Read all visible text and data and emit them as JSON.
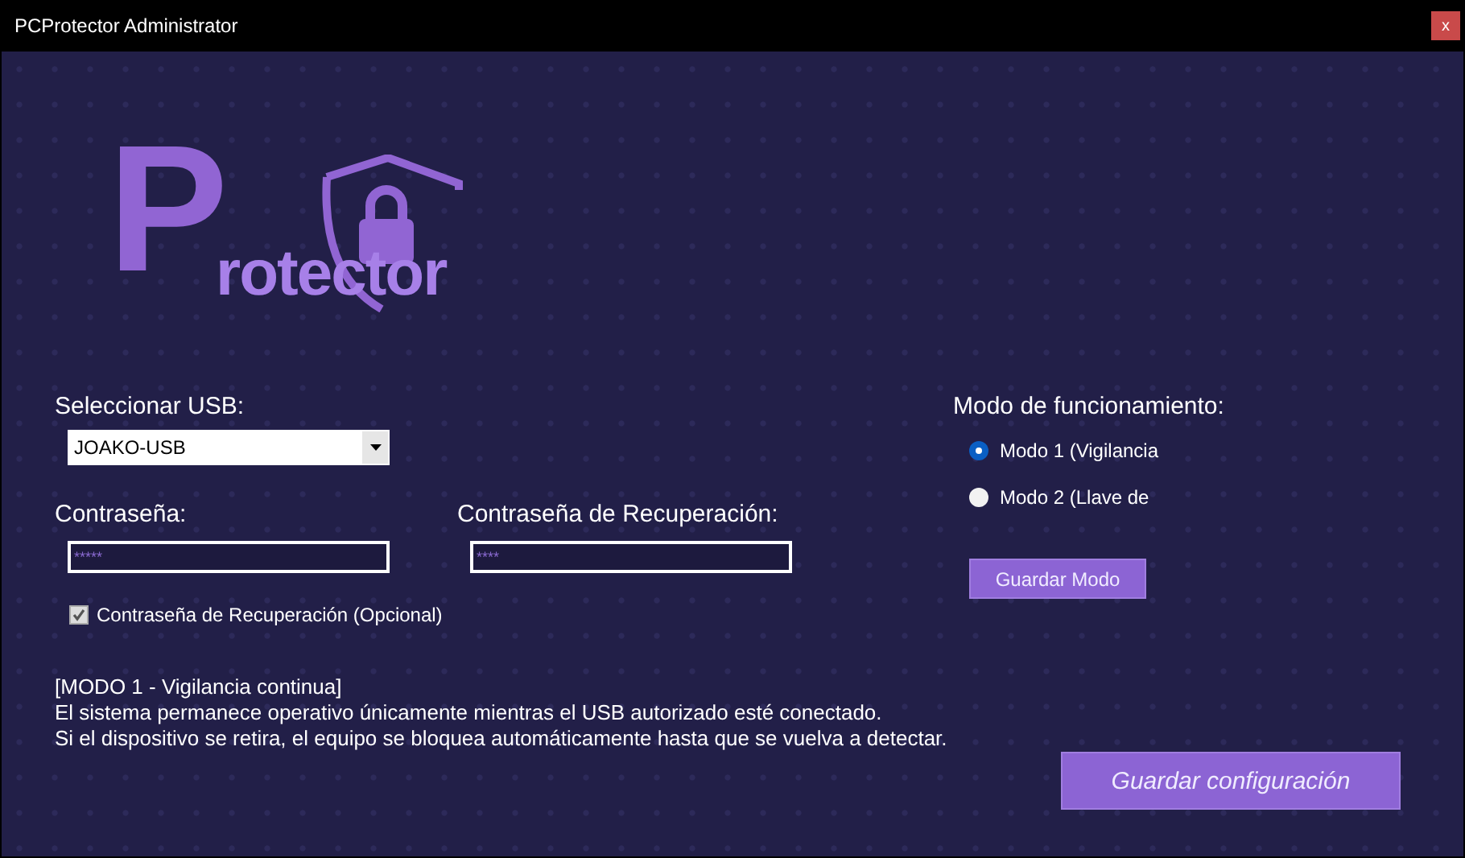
{
  "window": {
    "title": "PCProtector Administrator",
    "close": "x"
  },
  "logo": {
    "initial": "P",
    "rest": "rotector"
  },
  "usb": {
    "label": "Seleccionar USB:",
    "value": "JOAKO-USB"
  },
  "password": {
    "label": "Contraseña:",
    "value": "*****"
  },
  "recovery_password": {
    "label": "Contraseña de Recuperación:",
    "value": "****"
  },
  "recovery_checkbox": {
    "label": "Contraseña de Recuperación (Opcional)",
    "checked": true
  },
  "mode": {
    "label": "Modo de funcionamiento:",
    "options": [
      {
        "label": "Modo 1 (Vigilancia",
        "selected": true
      },
      {
        "label": "Modo 2 (Llave de",
        "selected": false
      }
    ],
    "button": "Guardar Modo"
  },
  "description": [
    "[MODO 1 - Vigilancia continua]",
    "El sistema permanece operativo únicamente mientras el USB autorizado esté conectado.",
    "Si el dispositivo se retira, el equipo se bloquea automáticamente hasta que se vuelva a detectar."
  ],
  "save_button": "Guardar configuración"
}
